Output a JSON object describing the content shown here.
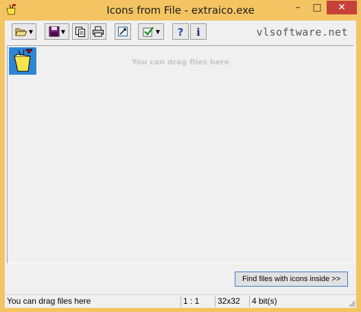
{
  "window": {
    "title": "Icons from File - extraico.exe",
    "controls": {
      "minimize": "–",
      "maximize": "□",
      "close": "✕"
    }
  },
  "toolbar": {
    "buttons": [
      {
        "name": "open-button",
        "icon": "folder-open-icon",
        "has_dropdown": true
      },
      {
        "name": "save-button",
        "icon": "floppy-disk-icon",
        "has_dropdown": true
      },
      {
        "name": "copy-button",
        "icon": "copy-icon",
        "has_dropdown": false
      },
      {
        "name": "print-button",
        "icon": "printer-icon",
        "has_dropdown": false
      },
      {
        "name": "resize-button",
        "icon": "resize-icon",
        "has_dropdown": false
      },
      {
        "name": "select-button",
        "icon": "checkmark-icon",
        "has_dropdown": true
      },
      {
        "name": "help-button",
        "icon": "question-icon",
        "has_dropdown": false
      },
      {
        "name": "about-button",
        "icon": "info-icon",
        "has_dropdown": false
      }
    ],
    "brand": "vlsoftware.net"
  },
  "main": {
    "hint": "You can drag files here",
    "icons": [
      {
        "name": "extracted-icon",
        "selected": true
      }
    ],
    "find_button": "Find files with icons inside >>"
  },
  "statusbar": {
    "message": "You can drag files here",
    "zoom": "1 : 1",
    "size": "32x32",
    "depth": "4 bit(s)"
  },
  "colors": {
    "frame": "#f4c463",
    "close": "#c7403a",
    "selection": "#2f86d6"
  }
}
